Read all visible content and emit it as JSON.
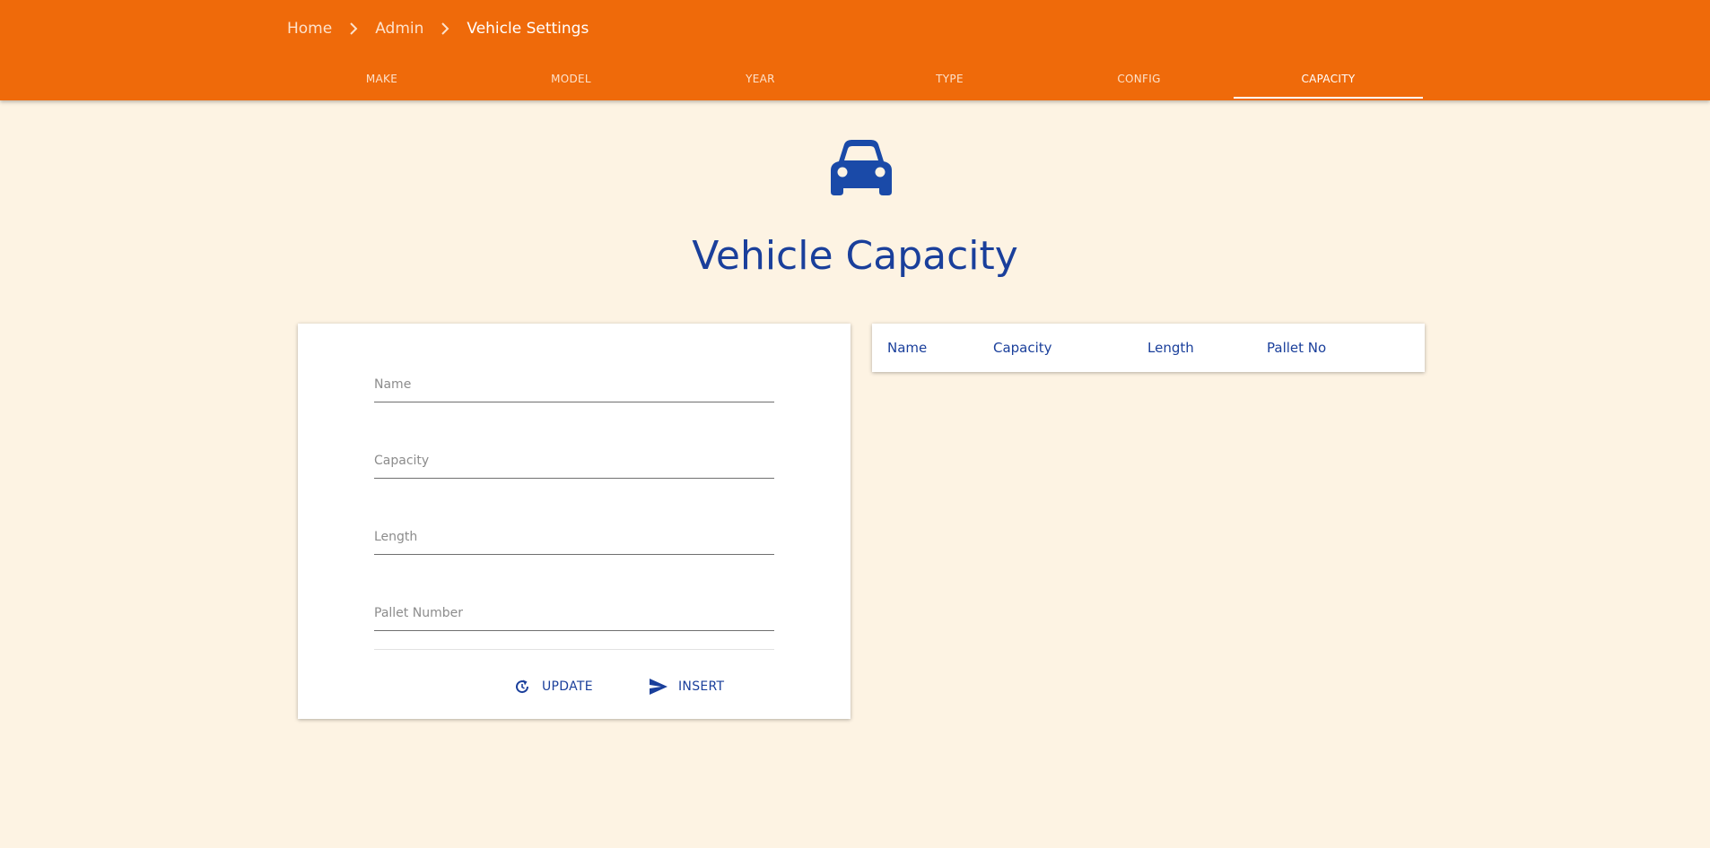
{
  "breadcrumb": {
    "home": "Home",
    "admin": "Admin",
    "current": "Vehicle Settings"
  },
  "tabs": [
    "MAKE",
    "MODEL",
    "YEAR",
    "TYPE",
    "CONFIG",
    "CAPACITY"
  ],
  "active_tab": "CAPACITY",
  "page": {
    "icon": "car-icon",
    "title": "Vehicle Capacity"
  },
  "form": {
    "name_placeholder": "Name",
    "capacity_placeholder": "Capacity",
    "length_placeholder": "Length",
    "pallet_placeholder": "Pallet Number",
    "name_value": "",
    "capacity_value": "",
    "length_value": "",
    "pallet_value": "",
    "update_label": "UPDATE",
    "update_icon": "refresh-icon",
    "insert_label": "INSERT",
    "insert_icon": "send-icon"
  },
  "table": {
    "columns": [
      "Name",
      "Capacity",
      "Length",
      "Pallet No"
    ],
    "rows": []
  },
  "colors": {
    "topbar": "#ef6a0a",
    "background": "#fdf3e3",
    "accent": "#1a3f9b"
  }
}
